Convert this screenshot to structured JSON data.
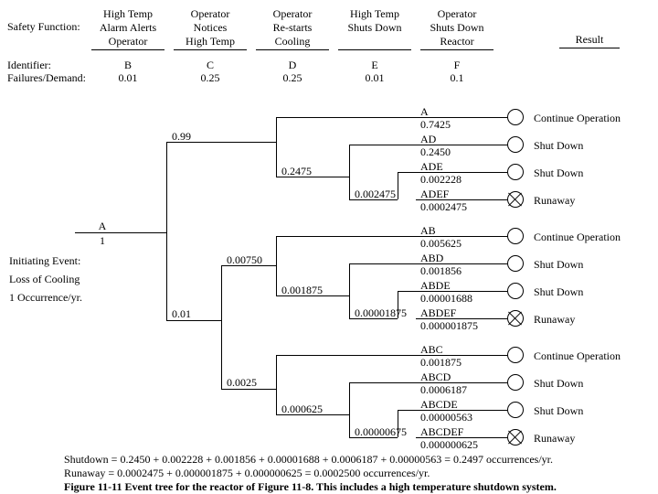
{
  "header": {
    "safety_function_label": "Safety Function:",
    "identifier_label": "Identifier:",
    "failures_label": "Failures/Demand:",
    "result_label": "Result",
    "cols": [
      {
        "fn": "High Temp\nAlarm Alerts\nOperator",
        "id": "B",
        "fd": "0.01"
      },
      {
        "fn": "Operator\nNotices\nHigh Temp",
        "id": "C",
        "fd": "0.25"
      },
      {
        "fn": "Operator\nRe-starts\nCooling",
        "id": "D",
        "fd": "0.25"
      },
      {
        "fn": "High Temp\nShuts Down",
        "id": "E",
        "fd": "0.01"
      },
      {
        "fn": "Operator\nShuts Down\nReactor",
        "id": "F",
        "fd": "0.1"
      }
    ]
  },
  "initiating": {
    "id": "A",
    "value": "1",
    "label": "Initiating Event:",
    "desc": "Loss of Cooling",
    "rate": "1 Occurrence/yr."
  },
  "branches": {
    "b_succ": "0.99",
    "b_fail": "0.01",
    "c_succ_from_bfail": "0.00750",
    "c_fail_from_bfail": "0.0025",
    "d_top": "0.2475",
    "d_mid": "0.001875",
    "d_bot": "0.000625",
    "e_top": "0.002475",
    "e_mid": "0.00001875",
    "e_bot": "0.00000675"
  },
  "outcomes": [
    {
      "seq": "A",
      "val": "0.7425",
      "res": "Continue Operation",
      "sym": "o"
    },
    {
      "seq": "AD",
      "val": "0.2450",
      "res": "Shut Down",
      "sym": "o"
    },
    {
      "seq": "ADE",
      "val": "0.002228",
      "res": "Shut Down",
      "sym": "o"
    },
    {
      "seq": "ADEF",
      "val": "0.0002475",
      "res": "Runaway",
      "sym": "x"
    },
    {
      "seq": "AB",
      "val": "0.005625",
      "res": "Continue Operation",
      "sym": "o"
    },
    {
      "seq": "ABD",
      "val": "0.001856",
      "res": "Shut Down",
      "sym": "o"
    },
    {
      "seq": "ABDE",
      "val": "0.00001688",
      "res": "Shut Down",
      "sym": "o"
    },
    {
      "seq": "ABDEF",
      "val": "0.000001875",
      "res": "Runaway",
      "sym": "x"
    },
    {
      "seq": "ABC",
      "val": "0.001875",
      "res": "Continue Operation",
      "sym": "o"
    },
    {
      "seq": "ABCD",
      "val": "0.0006187",
      "res": "Shut Down",
      "sym": "o"
    },
    {
      "seq": "ABCDE",
      "val": "0.00000563",
      "res": "Shut Down",
      "sym": "o"
    },
    {
      "seq": "ABCDEF",
      "val": "0.000000625",
      "res": "Runaway",
      "sym": "x"
    }
  ],
  "summary": {
    "shutdown": "Shutdown = 0.2450 + 0.002228 + 0.001856 + 0.00001688 + 0.0006187 + 0.00000563 = 0.2497 occurrences/yr.",
    "runaway": "Runaway = 0.0002475 + 0.000001875 + 0.000000625 = 0.0002500 occurrences/yr."
  },
  "caption": "Figure 11-11 Event tree for the reactor of Figure 11-8. This includes a high temperature shutdown system."
}
